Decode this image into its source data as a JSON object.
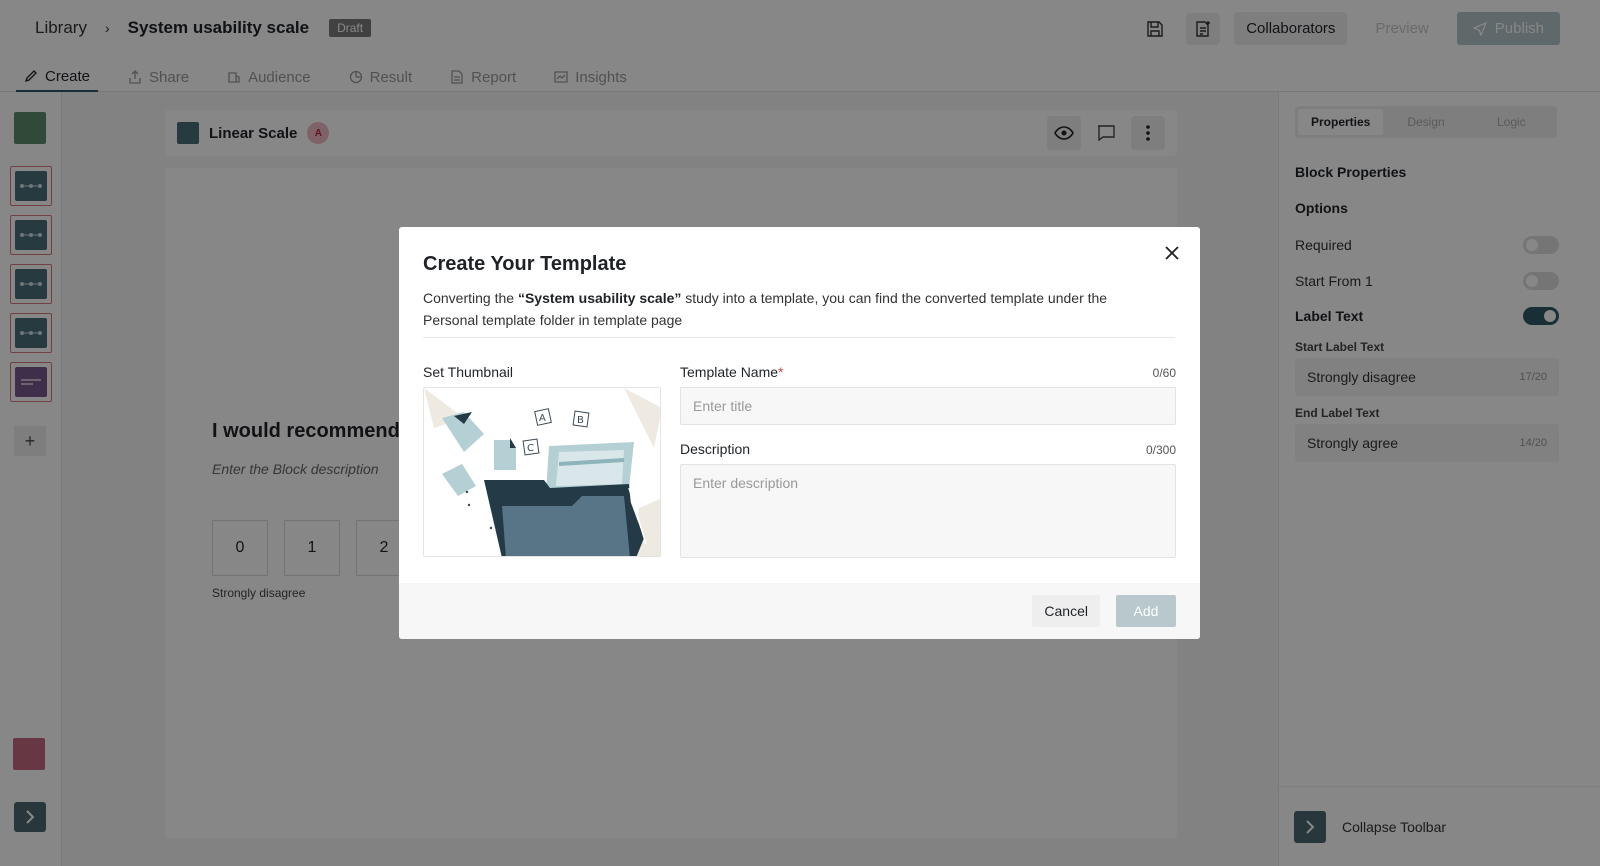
{
  "header": {
    "breadcrumb_library": "Library",
    "breadcrumb_separator": "›",
    "study_title": "System usability scale",
    "status_badge": "Draft",
    "collaborators_label": "Collaborators",
    "preview_label": "Preview",
    "publish_label": "Publish"
  },
  "tabs": [
    {
      "label": "Create",
      "icon": "pencil-icon",
      "active": true
    },
    {
      "label": "Share",
      "icon": "share-icon"
    },
    {
      "label": "Audience",
      "icon": "audience-icon"
    },
    {
      "label": "Result",
      "icon": "result-icon"
    },
    {
      "label": "Report",
      "icon": "report-icon"
    },
    {
      "label": "Insights",
      "icon": "insights-icon"
    }
  ],
  "block": {
    "name": "Linear Scale",
    "avatar_initial": "A",
    "question": "I would recommend",
    "description_placeholder": "Enter the Block description",
    "scale_values": [
      "0",
      "1",
      "2"
    ],
    "start_label": "Strongly disagree"
  },
  "right_panel": {
    "tabs": [
      "Properties",
      "Design",
      "Logic"
    ],
    "block_properties": "Block Properties",
    "options": "Options",
    "required": "Required",
    "start_from_1": "Start From 1",
    "label_text": "Label Text",
    "start_label_text_heading": "Start Label Text",
    "start_label_value": "Strongly disagree",
    "start_label_count": "17/20",
    "end_label_text_heading": "End Label Text",
    "end_label_value": "Strongly agree",
    "end_label_count": "14/20",
    "collapse_toolbar": "Collapse Toolbar",
    "toggles": {
      "required": false,
      "start_from_1": false,
      "label_text": true
    }
  },
  "modal": {
    "title": "Create Your Template",
    "desc_prefix": "Converting the ",
    "desc_study": "“System usability scale”",
    "desc_suffix": " study into a template, you can find the converted template under the Personal template folder in template page",
    "thumbnail_label": "Set Thumbnail",
    "template_name_label": "Template Name",
    "required_mark": "*",
    "template_name_count": "0/60",
    "template_name_placeholder": "Enter title",
    "description_label": "Description",
    "description_count": "0/300",
    "description_placeholder": "Enter description",
    "cancel_label": "Cancel",
    "add_label": "Add"
  },
  "colors": {
    "accent": "#2f5a66",
    "block_icon": "#4a6e78",
    "purple_block": "#7a5a8e"
  }
}
